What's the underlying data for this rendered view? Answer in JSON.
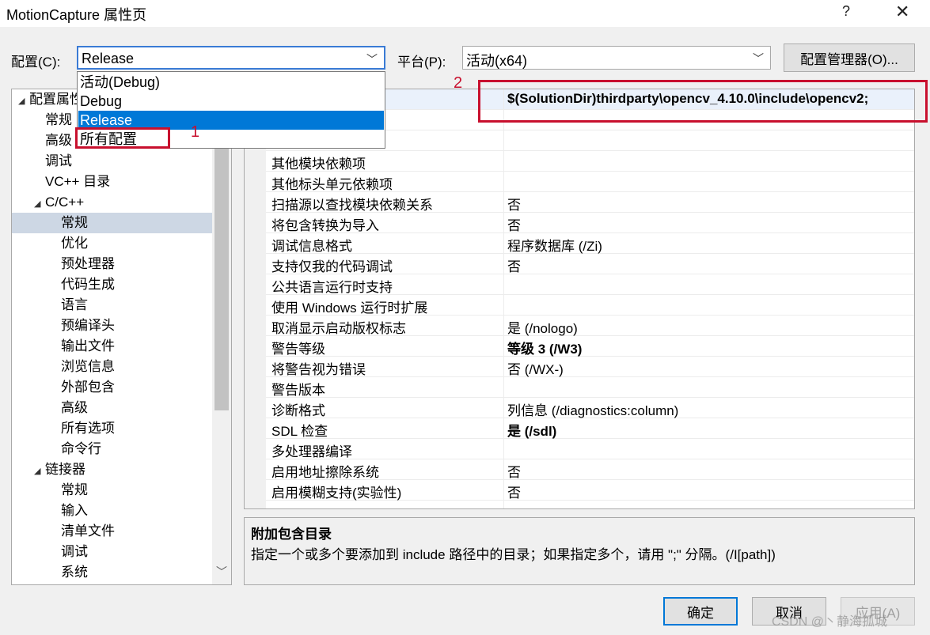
{
  "window": {
    "title": "MotionCapture 属性页",
    "help_glyph": "?",
    "close_glyph": "✕"
  },
  "config_bar": {
    "config_label": "配置(C):",
    "config_value": "Release",
    "platform_label": "平台(P):",
    "platform_value": "活动(x64)",
    "manager_button": "配置管理器(O)..."
  },
  "config_dropdown": {
    "options": [
      "活动(Debug)",
      "Debug",
      "Release",
      "所有配置"
    ],
    "selected_index": 2
  },
  "tree": {
    "items": [
      {
        "label": "配置属性",
        "expanded": true
      },
      {
        "label": "常规"
      },
      {
        "label": "高级"
      },
      {
        "label": "调试"
      },
      {
        "label": "VC++ 目录"
      },
      {
        "label": "C/C++",
        "expanded": true
      },
      {
        "label": "常规",
        "selected": true
      },
      {
        "label": "优化"
      },
      {
        "label": "预处理器"
      },
      {
        "label": "代码生成"
      },
      {
        "label": "语言"
      },
      {
        "label": "预编译头"
      },
      {
        "label": "输出文件"
      },
      {
        "label": "浏览信息"
      },
      {
        "label": "外部包含"
      },
      {
        "label": "高级"
      },
      {
        "label": "所有选项"
      },
      {
        "label": "命令行"
      },
      {
        "label": "链接器",
        "expanded": true
      },
      {
        "label": "常规"
      },
      {
        "label": "输入"
      },
      {
        "label": "清单文件"
      },
      {
        "label": "调试"
      },
      {
        "label": "系统"
      }
    ]
  },
  "grid": {
    "rows": [
      {
        "key": "",
        "value": "$(SolutionDir)thirdparty\\opencv_4.10.0\\include\\opencv2;",
        "bold": true
      },
      {
        "key": "",
        "value": ""
      },
      {
        "key": "",
        "value": ""
      },
      {
        "key": "其他模块依赖项",
        "value": ""
      },
      {
        "key": "其他标头单元依赖项",
        "value": ""
      },
      {
        "key": "扫描源以查找模块依赖关系",
        "value": "否"
      },
      {
        "key": "将包含转换为导入",
        "value": "否"
      },
      {
        "key": "调试信息格式",
        "value": "程序数据库 (/Zi)"
      },
      {
        "key": "支持仅我的代码调试",
        "value": "否"
      },
      {
        "key": "公共语言运行时支持",
        "value": ""
      },
      {
        "key": "使用 Windows 运行时扩展",
        "value": ""
      },
      {
        "key": "取消显示启动版权标志",
        "value": "是 (/nologo)"
      },
      {
        "key": "警告等级",
        "value": "等级 3 (/W3)",
        "bold": true
      },
      {
        "key": "将警告视为错误",
        "value": "否 (/WX-)"
      },
      {
        "key": "警告版本",
        "value": ""
      },
      {
        "key": "诊断格式",
        "value": "列信息 (/diagnostics:column)"
      },
      {
        "key": "SDL 检查",
        "value": "是 (/sdl)",
        "bold": true
      },
      {
        "key": "多处理器编译",
        "value": ""
      },
      {
        "key": "启用地址擦除系统",
        "value": "否"
      },
      {
        "key": "启用模糊支持(实验性)",
        "value": "否"
      }
    ]
  },
  "description": {
    "title": "附加包含目录",
    "body": "指定一个或多个要添加到 include 路径中的目录；如果指定多个，请用 \";\" 分隔。(/I[path])"
  },
  "buttons": {
    "ok": "确定",
    "cancel": "取消",
    "apply": "应用(A)"
  },
  "annotations": {
    "marker_1": "1",
    "marker_2": "2",
    "color": "#c8102e"
  },
  "watermark": "CSDN @丶静海孤城",
  "colors": {
    "accent": "#0078d7",
    "tree_selection": "#cdd7e4"
  }
}
